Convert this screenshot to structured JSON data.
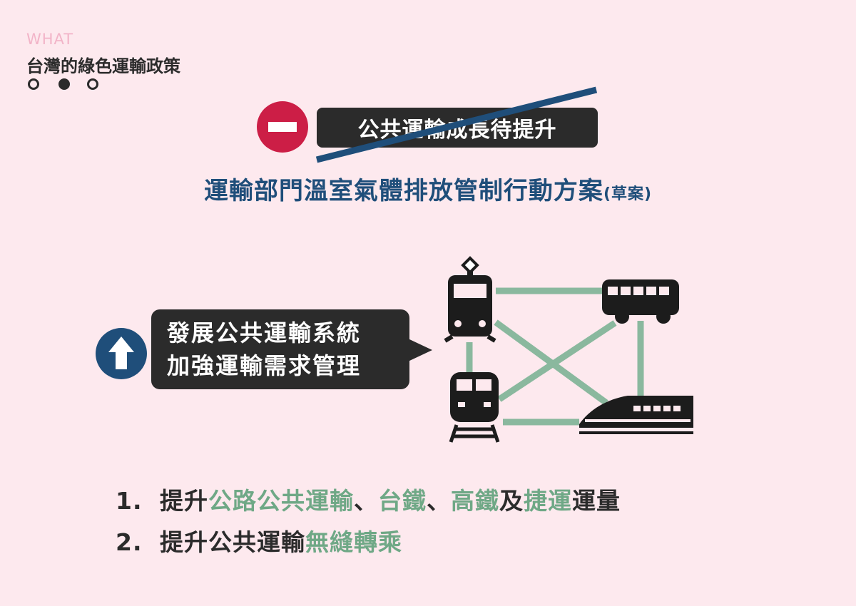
{
  "header": {
    "eyebrow": "WHAT",
    "title": "台灣的綠色運輸政策",
    "pager": {
      "total": 3,
      "current": 2
    }
  },
  "crossed_out_item": {
    "text": "公共運輸成長待提升",
    "badge_icon": "minus-icon",
    "badge_color": "#cc1e46",
    "strike_color": "#1f4e7a"
  },
  "plan": {
    "title": "運輸部門溫室氣體排放管制行動方案",
    "suffix": "(草案)"
  },
  "callout": {
    "badge_icon": "up-arrow-icon",
    "badge_color": "#1f4e7a",
    "line1": "發展公共運輸系統",
    "line2": "加強運輸需求管理"
  },
  "network": {
    "icons": [
      "tram-icon",
      "bus-icon",
      "metro-icon",
      "high-speed-rail-icon"
    ],
    "link_color": "#8ab89e"
  },
  "list": [
    {
      "num": "1.",
      "segments": [
        {
          "text": "提升",
          "green": false
        },
        {
          "text": "公路公共運輸",
          "green": true
        },
        {
          "text": "、",
          "green": false
        },
        {
          "text": "台鐵",
          "green": true
        },
        {
          "text": "、",
          "green": false
        },
        {
          "text": "高鐵",
          "green": true
        },
        {
          "text": "及",
          "green": false
        },
        {
          "text": "捷運",
          "green": true
        },
        {
          "text": "運量",
          "green": false
        }
      ]
    },
    {
      "num": "2.",
      "segments": [
        {
          "text": "提升公共運輸",
          "green": false
        },
        {
          "text": "無縫轉乘",
          "green": true
        }
      ]
    }
  ],
  "colors": {
    "background": "#fde9ee",
    "accent_green": "#6fa886",
    "dark": "#2b2b2b",
    "blue": "#1f4e7a"
  }
}
